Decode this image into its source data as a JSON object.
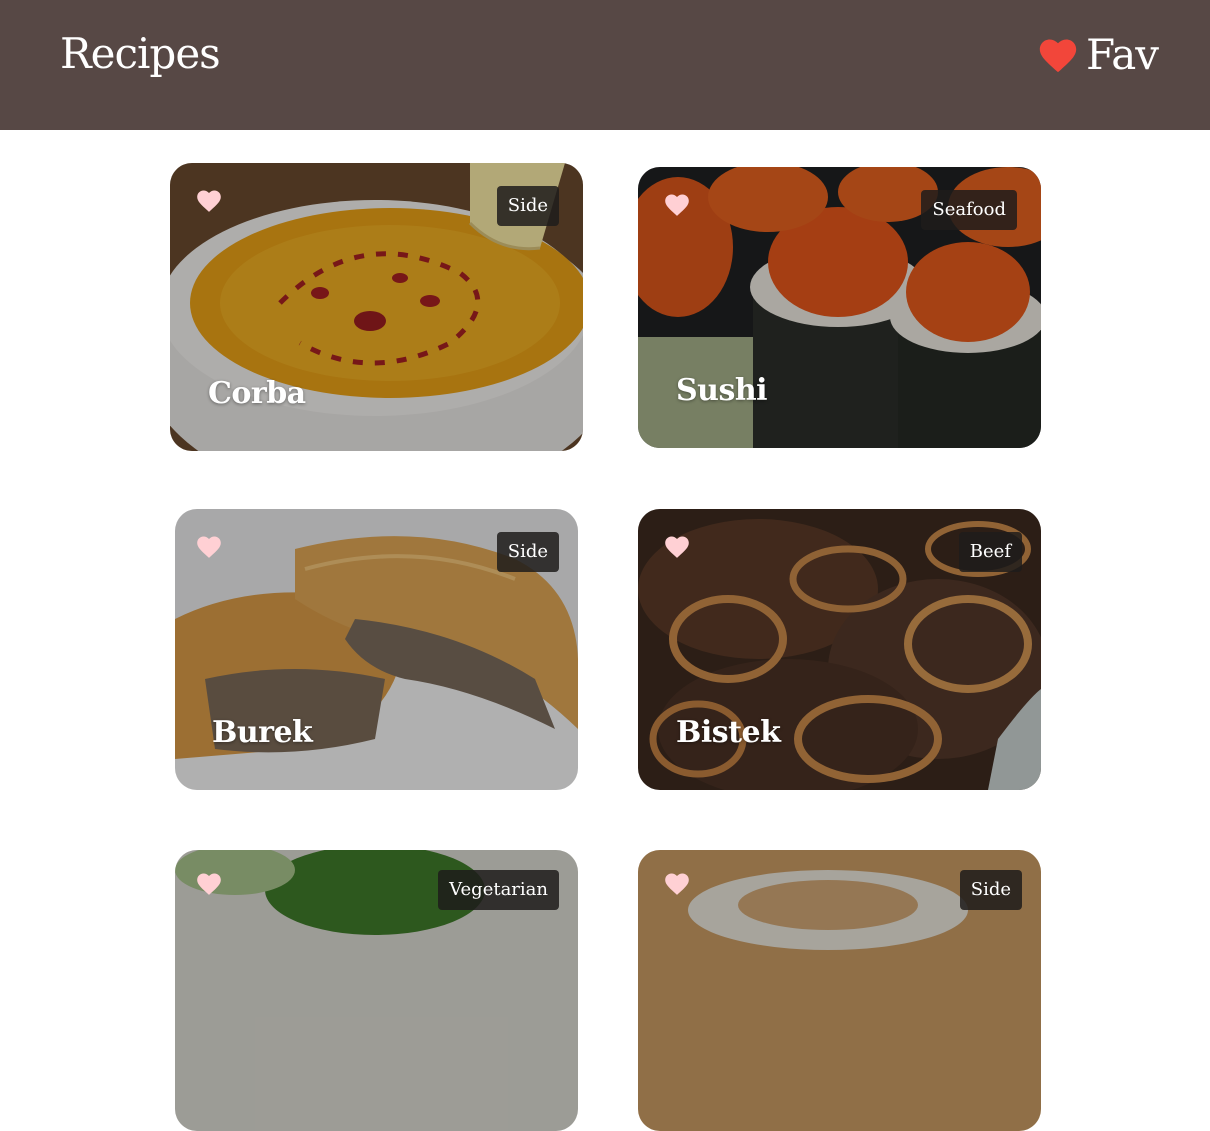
{
  "header": {
    "title": "Recipes",
    "fav_label": "Fav",
    "fav_icon": "heart-icon",
    "fav_icon_color": "#f2463a",
    "background": "#574845"
  },
  "recipes": [
    {
      "name": "Corba",
      "category": "Side",
      "liked_icon_color": "#ffd0d4"
    },
    {
      "name": "Sushi",
      "category": "Seafood",
      "liked_icon_color": "#ffd0d4"
    },
    {
      "name": "Burek",
      "category": "Side",
      "liked_icon_color": "#ffd0d4"
    },
    {
      "name": "Bistek",
      "category": "Beef",
      "liked_icon_color": "#ffd0d4"
    },
    {
      "name": "",
      "category": "Vegetarian",
      "liked_icon_color": "#ffd0d4"
    },
    {
      "name": "",
      "category": "Side",
      "liked_icon_color": "#ffd0d4"
    }
  ]
}
